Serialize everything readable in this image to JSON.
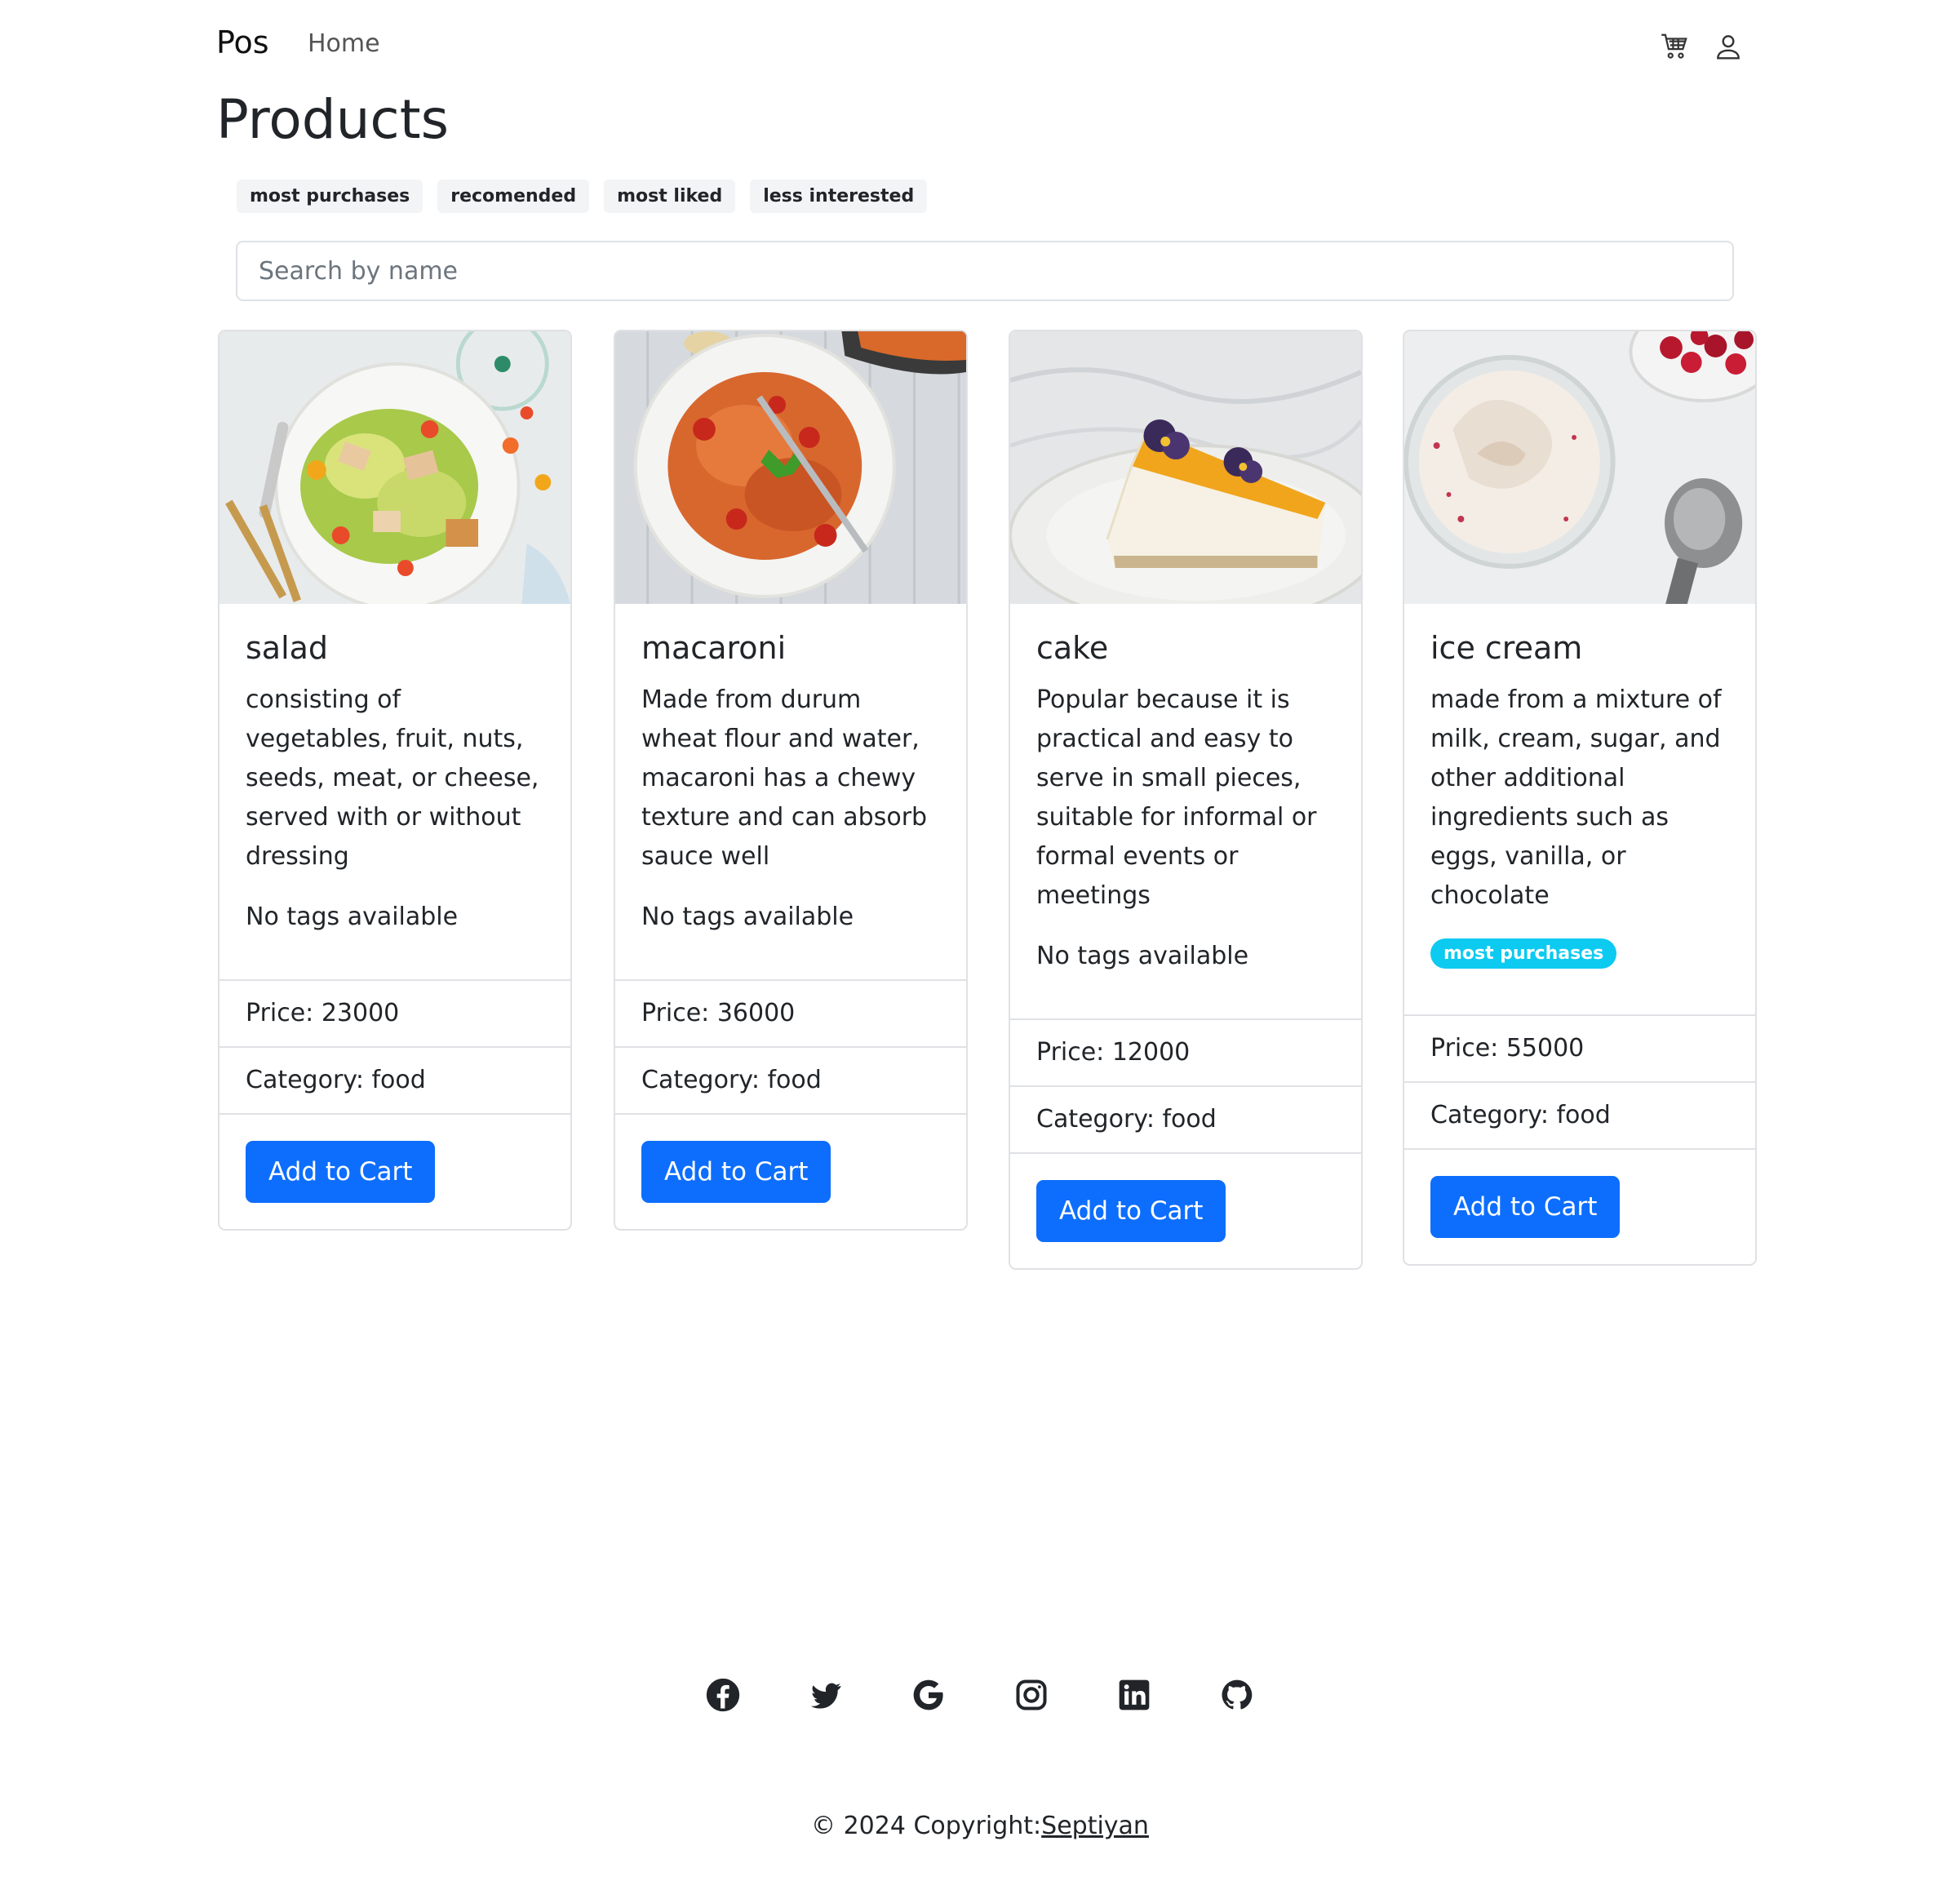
{
  "nav": {
    "brand": "Pos",
    "home": "Home",
    "cart_icon": "cart-icon",
    "user_icon": "user-icon"
  },
  "page": {
    "title": "Products"
  },
  "filters": [
    "most purchases",
    "recomended",
    "most liked",
    "less interested"
  ],
  "search": {
    "placeholder": "Search by name",
    "value": ""
  },
  "products": [
    {
      "name": "salad",
      "description": "consisting of vegetables, fruit, nuts, seeds, meat, or cheese, served with or without dressing",
      "tags_text": "No tags available",
      "price": "Price: 23000",
      "category": "Category: food",
      "button": "Add to Cart"
    },
    {
      "name": "macaroni",
      "description": "Made from durum wheat flour and water, macaroni has a chewy texture and can absorb sauce well",
      "tags_text": "No tags available",
      "price": "Price: 36000",
      "category": "Category: food",
      "button": "Add to Cart"
    },
    {
      "name": "cake",
      "description": "Popular because it is practical and easy to serve in small pieces, suitable for informal or formal events or meetings",
      "tags_text": "No tags available",
      "price": "Price: 12000",
      "category": "Category: food",
      "button": "Add to Cart"
    },
    {
      "name": "ice cream",
      "description": "made from a mixture of milk, cream, sugar, and other additional ingredients such as eggs, vanilla, or chocolate",
      "tag": "most purchases",
      "price": "Price: 55000",
      "category": "Category: food",
      "button": "Add to Cart"
    }
  ],
  "footer": {
    "social": [
      "facebook-icon",
      "twitter-icon",
      "google-icon",
      "instagram-icon",
      "linkedin-icon",
      "github-icon"
    ],
    "copyright_prefix": "© 2024 Copyright:",
    "copyright_link": "Septiyan"
  },
  "colors": {
    "primary": "#0d6efd",
    "info_badge": "#0dcaf0",
    "border": "#dfe1e4"
  }
}
